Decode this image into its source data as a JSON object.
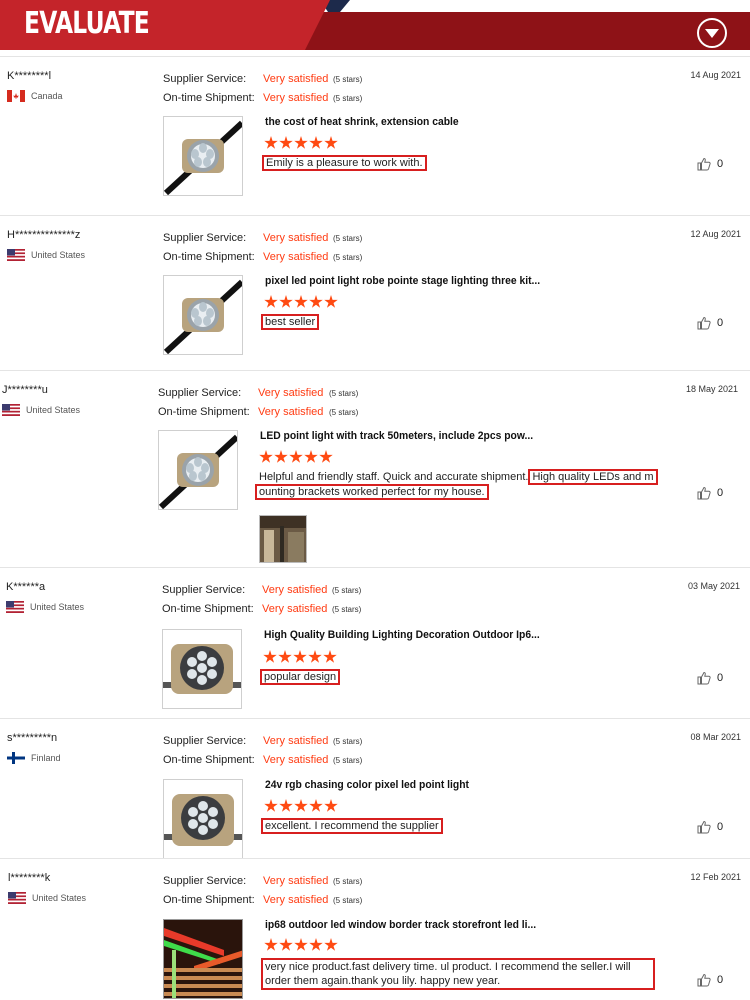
{
  "header": {
    "title": "EVALUATE"
  },
  "labels": {
    "supplier": "Supplier Service:",
    "shipment": "On-time Shipment:"
  },
  "reviews": [
    {
      "user": "K********l",
      "country": "Canada",
      "flag": "canada",
      "date": "14 Aug 2021",
      "supplier_val": "Very satisfied",
      "supplier_stars": "(5 stars)",
      "shipment_val": "Very satisfied",
      "shipment_stars": "(5 stars)",
      "product_title": "the cost of heat shrink, extension cable",
      "product_icon": "led-point-light-5",
      "comment_plain": "",
      "comment_boxed": "Emily is a pleasure to work with.",
      "likes": "0"
    },
    {
      "user": "H**************z",
      "country": "United States",
      "flag": "usa",
      "date": "12 Aug 2021",
      "supplier_val": "Very satisfied",
      "supplier_stars": "(5 stars)",
      "shipment_val": "Very satisfied",
      "shipment_stars": "(5 stars)",
      "product_title": "pixel led point light robe pointe stage lighting three kit...",
      "product_icon": "led-point-light-5",
      "comment_plain": "",
      "comment_boxed": "best seller",
      "likes": "0"
    },
    {
      "user": "J********u",
      "country": "United States",
      "flag": "usa",
      "date": "18 May 2021",
      "supplier_val": "Very satisfied",
      "supplier_stars": "(5 stars)",
      "shipment_val": "Very satisfied",
      "shipment_stars": "(5 stars)",
      "product_title": "LED point light with track 50meters, include 2pcs pow...",
      "product_icon": "led-point-light-5",
      "comment_plain": "Helpful and friendly staff. Quick and accurate shipment.",
      "comment_boxed_a": "High quality LEDs and m",
      "comment_boxed_b": "ounting brackets worked perfect for my house.",
      "likes": "0"
    },
    {
      "user": "K******a",
      "country": "United States",
      "flag": "usa",
      "date": "03 May 2021",
      "supplier_val": "Very satisfied",
      "supplier_stars": "(5 stars)",
      "shipment_val": "Very satisfied",
      "shipment_stars": "(5 stars)",
      "product_title": "High Quality Building Lighting Decoration Outdoor Ip6...",
      "product_icon": "led-point-light-7",
      "comment_plain": "",
      "comment_boxed": "popular design",
      "likes": "0"
    },
    {
      "user": "s*********n",
      "country": "Finland",
      "flag": "finland",
      "date": "08 Mar 2021",
      "supplier_val": "Very satisfied",
      "supplier_stars": "(5 stars)",
      "shipment_val": "Very satisfied",
      "shipment_stars": "(5 stars)",
      "product_title": "24v rgb chasing color pixel led point light",
      "product_icon": "led-point-light-7",
      "comment_plain": "",
      "comment_boxed": "excellent. I recommend the supplier",
      "likes": "0"
    },
    {
      "user": "l********k",
      "country": "United States",
      "flag": "usa",
      "date": "12 Feb 2021",
      "supplier_val": "Very satisfied",
      "supplier_stars": "(5 stars)",
      "shipment_val": "Very satisfied",
      "shipment_stars": "(5 stars)",
      "product_title": "ip68 outdoor led window border track storefront led li...",
      "product_icon": "storefront-lighting-photo",
      "comment_plain": "",
      "comment_boxed": "very nice product.fast delivery time. ul product. I recommend the seller.I will order them again.thank you lily. happy new year.",
      "likes": "0"
    }
  ],
  "colors": {
    "header_red": "#8e1217",
    "tab_red": "#c4242a",
    "accent_orange": "#ff3b12",
    "box_red": "#d71f1f"
  }
}
